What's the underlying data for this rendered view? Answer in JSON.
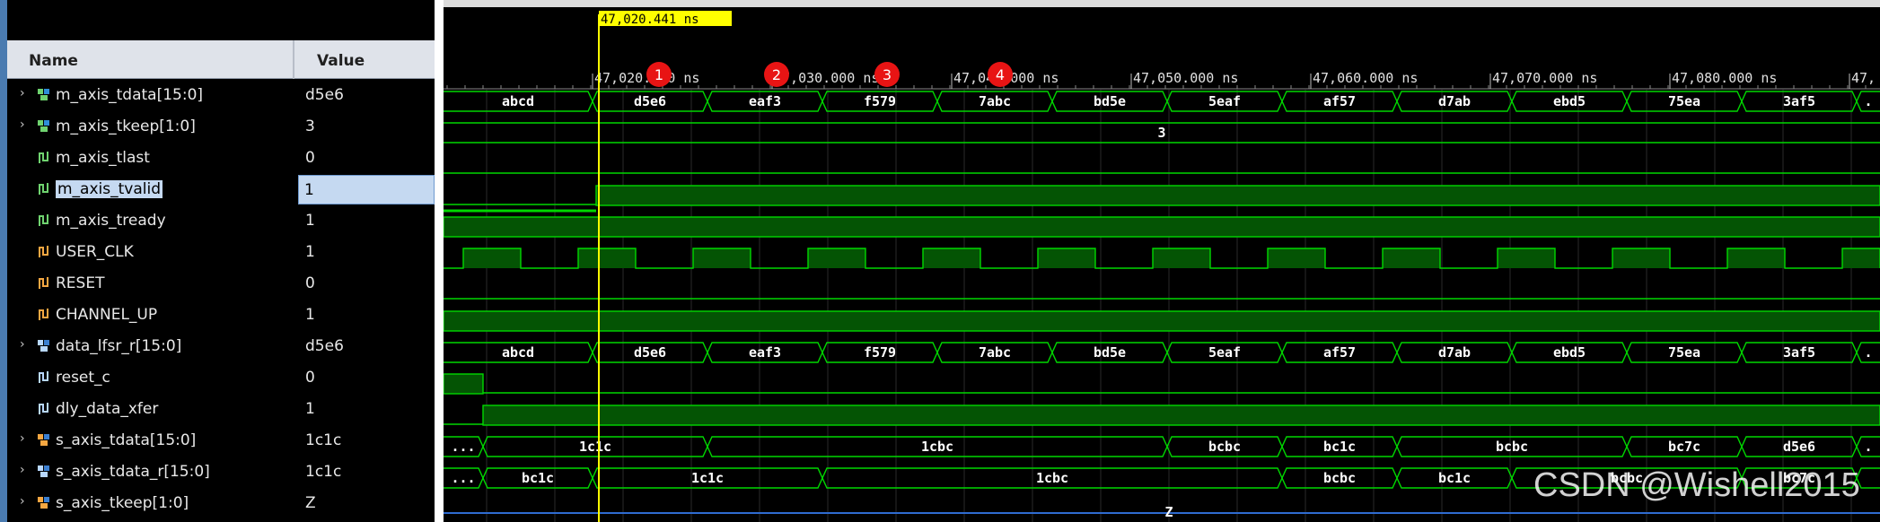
{
  "columns": {
    "name": "Name",
    "value": "Value"
  },
  "signals": [
    {
      "name": "m_axis_tdata[15:0]",
      "value": "d5e6",
      "expandable": true,
      "icon": "bus-icon"
    },
    {
      "name": "m_axis_tkeep[1:0]",
      "value": "3",
      "expandable": true,
      "icon": "bus-icon"
    },
    {
      "name": "m_axis_tlast",
      "value": "0",
      "expandable": false,
      "icon": "wire-icon"
    },
    {
      "name": "m_axis_tvalid",
      "value": "1",
      "expandable": false,
      "icon": "wire-icon",
      "selected": true
    },
    {
      "name": "m_axis_tready",
      "value": "1",
      "expandable": false,
      "icon": "wire-icon"
    },
    {
      "name": "USER_CLK",
      "value": "1",
      "expandable": false,
      "icon": "input-wire-icon"
    },
    {
      "name": "RESET",
      "value": "0",
      "expandable": false,
      "icon": "input-wire-icon"
    },
    {
      "name": "CHANNEL_UP",
      "value": "1",
      "expandable": false,
      "icon": "input-wire-icon"
    },
    {
      "name": "data_lfsr_r[15:0]",
      "value": "d5e6",
      "expandable": true,
      "icon": "reg-bus-icon"
    },
    {
      "name": "reset_c",
      "value": "0",
      "expandable": false,
      "icon": "reg-wire-icon"
    },
    {
      "name": "dly_data_xfer",
      "value": "1",
      "expandable": false,
      "icon": "reg-wire-icon"
    },
    {
      "name": "s_axis_tdata[15:0]",
      "value": "1c1c",
      "expandable": true,
      "icon": "orange-bus-icon"
    },
    {
      "name": "s_axis_tdata_r[15:0]",
      "value": "1c1c",
      "expandable": true,
      "icon": "reg-bus-icon"
    },
    {
      "name": "s_axis_tkeep[1:0]",
      "value": "Z",
      "expandable": true,
      "icon": "orange-bus-icon"
    }
  ],
  "cursor": {
    "label": "47,020.441 ns"
  },
  "ruler": {
    "ticks": [
      "47,020.000 ns",
      "47,030.000 ns",
      "47,040.000 ns",
      "47,050.000 ns",
      "47,060.000 ns",
      "47,070.000 ns",
      "47,080.000 ns",
      "47,"
    ]
  },
  "markers": [
    "1",
    "2",
    "3",
    "4"
  ],
  "bus_values": {
    "m_axis_tdata": [
      "abcd",
      "d5e6",
      "eaf3",
      "f579",
      "7abc",
      "bd5e",
      "5eaf",
      "af57",
      "d7ab",
      "ebd5",
      "75ea",
      "3af5",
      "."
    ],
    "m_axis_tkeep": [
      "3"
    ],
    "data_lfsr_r": [
      "abcd",
      "d5e6",
      "eaf3",
      "f579",
      "7abc",
      "bd5e",
      "5eaf",
      "af57",
      "d7ab",
      "ebd5",
      "75ea",
      "3af5",
      "."
    ],
    "s_axis_tdata": [
      "...",
      "1c1c",
      "1cbc",
      "bcbc",
      "bc1c",
      "bcbc",
      "bc7c",
      "d5e6",
      "."
    ],
    "s_axis_tdata_r": [
      "...",
      "bc1c",
      "1c1c",
      "1cbc",
      "bcbc",
      "bc1c",
      "bcbc",
      "bc7c"
    ],
    "s_axis_tkeep": [
      "Z"
    ]
  },
  "watermark": "CSDN @Wishell2015",
  "colors": {
    "wave_green": "#00d800",
    "fill_green": "#045404",
    "cursor": "#ffff00",
    "marker_red": "#e81414",
    "grid": "#2a2a2a",
    "selection": "#c5d9f1"
  }
}
